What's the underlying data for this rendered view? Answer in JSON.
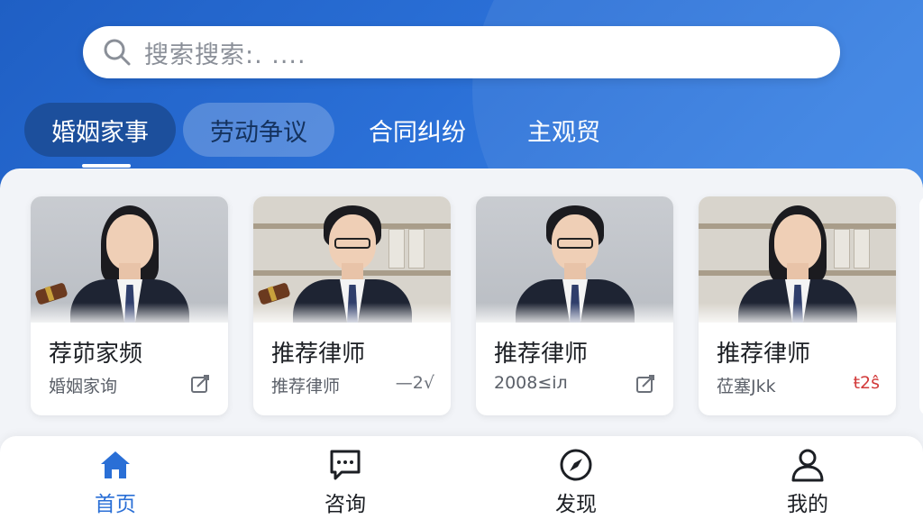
{
  "search": {
    "placeholder": "搜索搜索:. ...."
  },
  "tabs": [
    {
      "label": "婚姻家事",
      "active": true
    },
    {
      "label": "劳动争议",
      "active": false
    },
    {
      "label": "合同纠纷",
      "active": false
    },
    {
      "label": "主观贸",
      "active": false
    }
  ],
  "cards": [
    {
      "title": "荐茆家频",
      "subtitle": "婚姻家询",
      "action": "",
      "action_icon": "edit-icon"
    },
    {
      "title": "推荐律师",
      "subtitle": "推荐律师",
      "action": "—2√",
      "action_icon": ""
    },
    {
      "title": "推荐律师",
      "subtitle": "2008≤iл",
      "action": "",
      "action_icon": "edit-icon"
    },
    {
      "title": "推荐律师",
      "subtitle": "莅塞Jkk",
      "action": "ŧ2ŝ",
      "action_icon": ""
    }
  ],
  "bottom_nav": [
    {
      "label": "首页",
      "icon": "home-icon",
      "active": true
    },
    {
      "label": "咨询",
      "icon": "chat-icon",
      "active": false
    },
    {
      "label": "发现",
      "icon": "compass-icon",
      "active": false
    },
    {
      "label": "我的",
      "icon": "user-icon",
      "active": false
    }
  ],
  "colors": {
    "header_blue": "#2a6fd6",
    "active_tab": "#1c4f9c",
    "nav_active": "#2a6fd6",
    "action_red": "#d23a3a"
  }
}
